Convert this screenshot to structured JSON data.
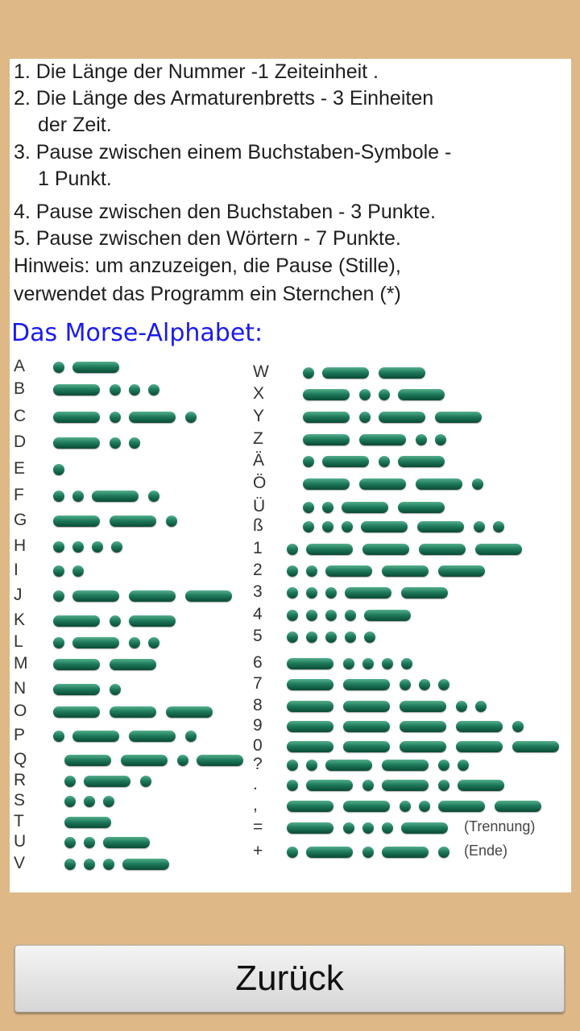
{
  "rules": [
    {
      "lines": [
        "1. Die Länge der Nummer -1 Zeiteinheit ."
      ]
    },
    {
      "lines": [
        "2. Die Länge des Armaturenbretts - 3 Einheiten",
        "der Zeit."
      ]
    },
    {
      "lines": [
        "3. Pause zwischen einem Buchstaben-Symbole -",
        "1 Punkt."
      ]
    },
    {
      "lines": [
        "4. Pause zwischen den Buchstaben - 3 Punkte."
      ]
    },
    {
      "lines": [
        "5. Pause zwischen den Wörtern - 7 Punkte."
      ]
    },
    {
      "lines": [
        "Hinweis: um anzuzeigen, die Pause (Stille),"
      ]
    },
    {
      "lines": [
        "verwendet das Programm ein Sternchen (*)"
      ]
    }
  ],
  "alphabet_title": "Das Morse-Alphabet:",
  "left_column": [
    {
      "char": "A",
      "code": ".-"
    },
    {
      "char": "B",
      "code": "-..."
    },
    {
      "char": "C",
      "code": "-.-."
    },
    {
      "char": "D",
      "code": "-.."
    },
    {
      "char": "E",
      "code": "."
    },
    {
      "char": "F",
      "code": "..-."
    },
    {
      "char": "G",
      "code": "--."
    },
    {
      "char": "H",
      "code": "...."
    },
    {
      "char": "I",
      "code": ".."
    },
    {
      "char": "J",
      "code": ".---"
    },
    {
      "char": "K",
      "code": "-.-"
    },
    {
      "char": "L",
      "code": ".-.."
    },
    {
      "char": "M",
      "code": "--"
    },
    {
      "char": "N",
      "code": "-."
    },
    {
      "char": "O",
      "code": "---"
    },
    {
      "char": "P",
      "code": ".--."
    },
    {
      "char": "Q",
      "code": "--.-"
    },
    {
      "char": "R",
      "code": ".-."
    },
    {
      "char": "S",
      "code": "..."
    },
    {
      "char": "T",
      "code": "-"
    },
    {
      "char": "U",
      "code": "..-"
    },
    {
      "char": "V",
      "code": "...-"
    }
  ],
  "right_column": [
    {
      "char": "W",
      "code": ".--"
    },
    {
      "char": "X",
      "code": "-..-"
    },
    {
      "char": "Y",
      "code": "-.--"
    },
    {
      "char": "Z",
      "code": "--.."
    },
    {
      "char": "Ä",
      "code": ".-.-"
    },
    {
      "char": "Ö",
      "code": "---."
    },
    {
      "char": "Ü",
      "code": "..--"
    },
    {
      "char": "ß",
      "code": "...--.."
    },
    {
      "char": "1",
      "code": ".----"
    },
    {
      "char": "2",
      "code": "..---"
    },
    {
      "char": "3",
      "code": "...--"
    },
    {
      "char": "4",
      "code": "....-"
    },
    {
      "char": "5",
      "code": "....."
    },
    {
      "char": "6",
      "code": "-...."
    },
    {
      "char": "7",
      "code": "--..."
    },
    {
      "char": "8",
      "code": "---.."
    },
    {
      "char": "9",
      "code": "----."
    },
    {
      "char": "0",
      "code": "-----"
    },
    {
      "char": "?",
      "code": "..--.."
    },
    {
      "char": ".",
      "code": ".-.-.-"
    },
    {
      "char": ",",
      "code": "--..--"
    },
    {
      "char": "=",
      "code": "-...-",
      "note": "(Trennung)"
    },
    {
      "char": "+",
      "code": ".-.-.",
      "note": "(Ende)"
    }
  ],
  "back_button": "Zurück"
}
